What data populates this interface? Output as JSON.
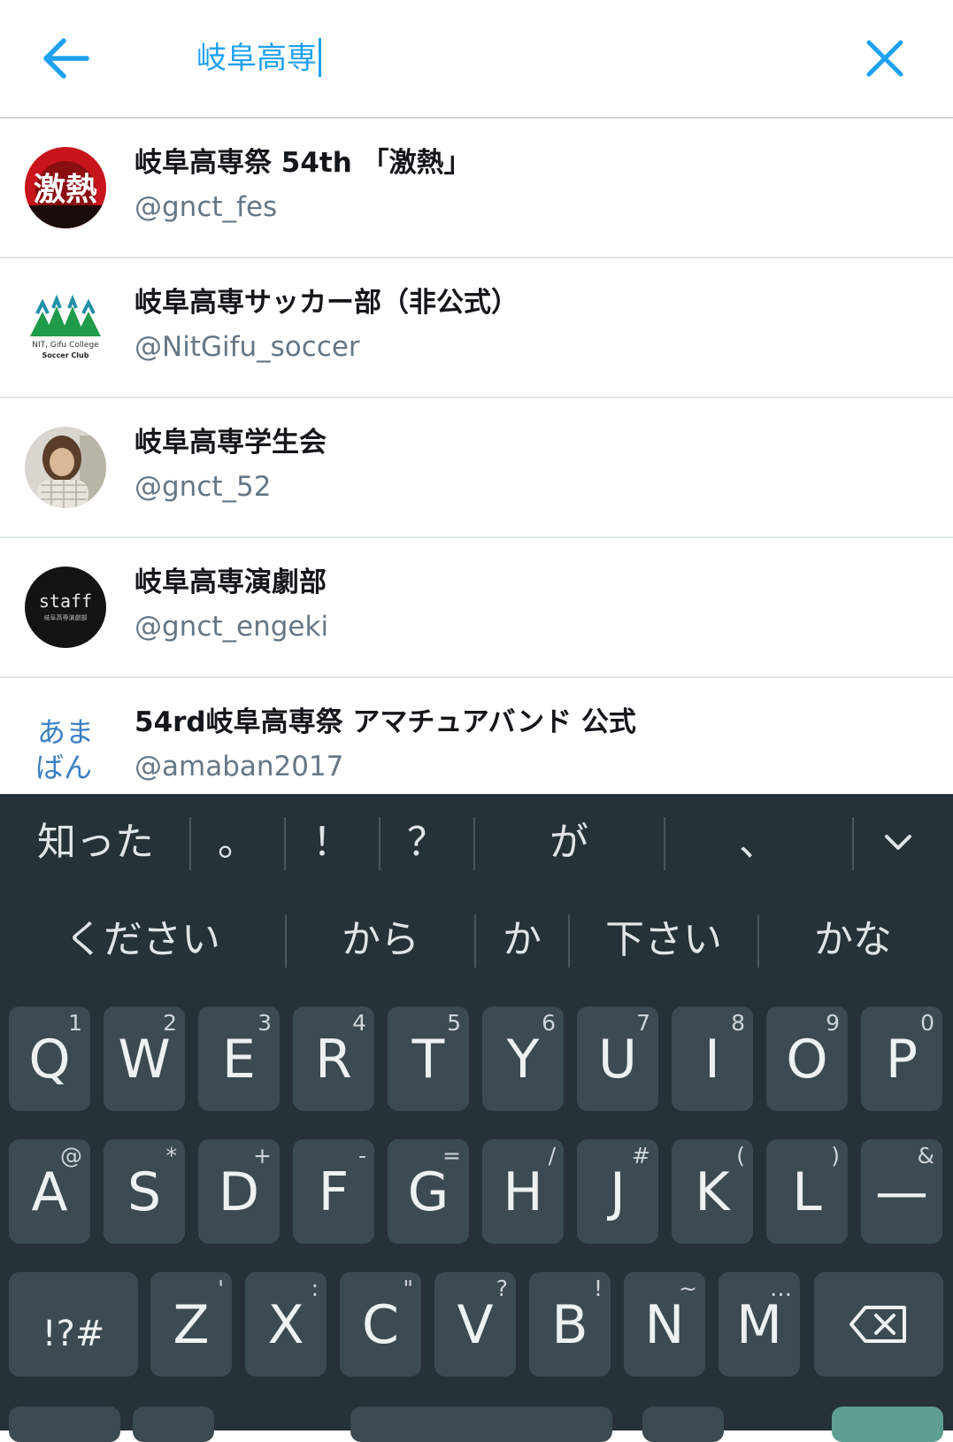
{
  "header": {
    "back_icon": "arrow-left-icon",
    "search_value": "岐阜高専",
    "close_icon": "close-x-icon",
    "accent": "#1da1f2"
  },
  "results": [
    {
      "name": "岐阜高専祭 54th 「激熱」",
      "handle": "@gnct_fes"
    },
    {
      "name": "岐阜高専サッカー部（非公式）",
      "handle": "@NitGifu_soccer"
    },
    {
      "name": "岐阜高専学生会",
      "handle": "@gnct_52"
    },
    {
      "name": "岐阜高専演劇部",
      "handle": "@gnct_engeki"
    },
    {
      "name": "54rd岐阜高専祭 アマチュアバンド 公式",
      "handle": "@amaban2017"
    }
  ],
  "avatars": {
    "fes_text": "激熱",
    "soccer_line1": "NIT, Gifu College",
    "soccer_line2": "Soccer Club",
    "engeki_text": "staff",
    "engeki_sub": "岐阜高専演劇部",
    "amaban_line1": "あま",
    "amaban_line2": "ばん"
  },
  "keyboard": {
    "suggestions_row1": [
      "知った",
      "。",
      "！",
      "？",
      "が",
      "、"
    ],
    "suggestions_row2": [
      "ください",
      "から",
      "か",
      "下さい",
      "かな"
    ],
    "expand_icon": "chevron-down-icon",
    "row1": [
      {
        "key": "Q",
        "hint": "1"
      },
      {
        "key": "W",
        "hint": "2"
      },
      {
        "key": "E",
        "hint": "3"
      },
      {
        "key": "R",
        "hint": "4"
      },
      {
        "key": "T",
        "hint": "5"
      },
      {
        "key": "Y",
        "hint": "6"
      },
      {
        "key": "U",
        "hint": "7"
      },
      {
        "key": "I",
        "hint": "8"
      },
      {
        "key": "O",
        "hint": "9"
      },
      {
        "key": "P",
        "hint": "0"
      }
    ],
    "row2": [
      {
        "key": "A",
        "hint": "@"
      },
      {
        "key": "S",
        "hint": "*"
      },
      {
        "key": "D",
        "hint": "+"
      },
      {
        "key": "F",
        "hint": "-"
      },
      {
        "key": "G",
        "hint": "="
      },
      {
        "key": "H",
        "hint": "/"
      },
      {
        "key": "J",
        "hint": "#"
      },
      {
        "key": "K",
        "hint": "("
      },
      {
        "key": "L",
        "hint": ")"
      },
      {
        "key": "—",
        "hint": "&"
      }
    ],
    "row3": [
      {
        "key": "Z",
        "hint": "'"
      },
      {
        "key": "X",
        "hint": ":"
      },
      {
        "key": "C",
        "hint": "\""
      },
      {
        "key": "V",
        "hint": "?"
      },
      {
        "key": "B",
        "hint": "!"
      },
      {
        "key": "N",
        "hint": "~"
      },
      {
        "key": "M",
        "hint": "…"
      }
    ],
    "symbols_key": "!?#",
    "backspace_icon": "backspace-icon"
  }
}
